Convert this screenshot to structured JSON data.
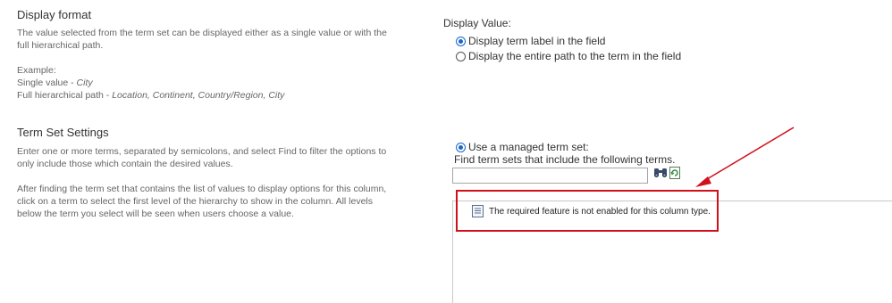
{
  "display_format": {
    "heading": "Display format",
    "desc_line1": "The value selected from the term set can be displayed either as a single value or with the",
    "desc_line2": "full hierarchical path.",
    "example_label": "Example:",
    "single_prefix": "Single value - ",
    "single_value": "City",
    "full_prefix": "Full hierarchical path - ",
    "full_value": "Location, Continent, Country/Region, City"
  },
  "display_value": {
    "label": "Display Value:",
    "options": [
      {
        "label": "Display term label in the field",
        "checked": true
      },
      {
        "label": "Display the entire path to the term in the field",
        "checked": false
      }
    ]
  },
  "term_set_settings": {
    "heading": "Term Set Settings",
    "para1_line1": "Enter one or more terms, separated by semicolons, and select Find to filter the options to",
    "para1_line2": "only include those which contain the desired values.",
    "para2_line1": "After finding the term set that contains the list of values to display options for this column,",
    "para2_line2": "click on a term to select the first level of the hierarchy to show in the column. All levels",
    "para2_line3": "below the term you select will be seen when users choose a value."
  },
  "managed_term_set": {
    "radio_label": "Use a managed term set:",
    "checked": true,
    "find_label": "Find term sets that include the following terms.",
    "search_value": "",
    "find_icon": "binoculars-icon",
    "refresh_icon": "reset-icon",
    "message": "The required feature is not enabled for this column type.",
    "message_icon": "document-icon"
  },
  "annotation": {
    "color": "#d0101a"
  }
}
